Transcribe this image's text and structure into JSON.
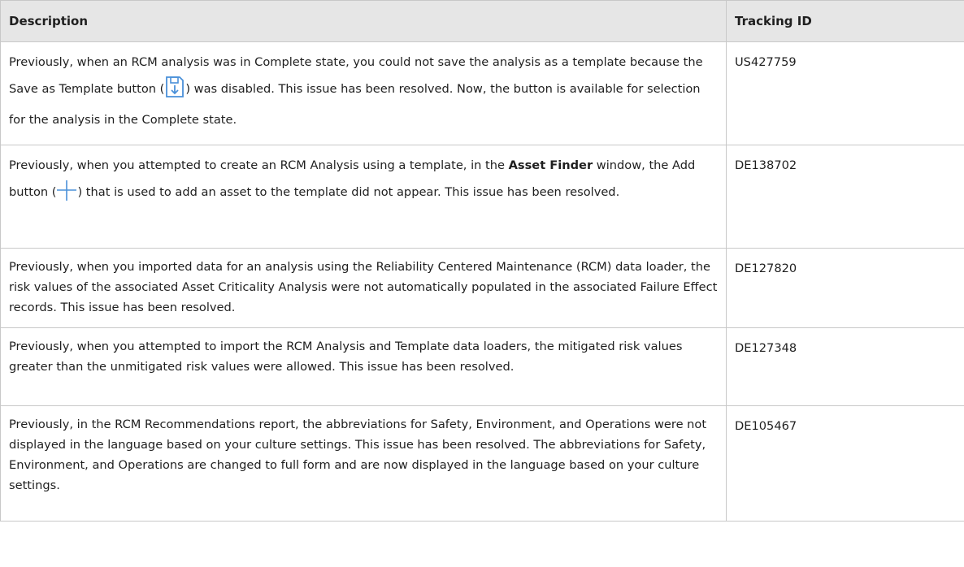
{
  "table": {
    "headers": {
      "description": "Description",
      "tracking_id": "Tracking ID"
    },
    "rows": [
      {
        "description_parts": [
          "Previously, when an RCM analysis was in Complete state, you could not save the analysis as a template because the Save as Template button (",
          ") was disabled. This issue has been resolved. Now, the button is available for selection for the analysis in the Complete state."
        ],
        "icon": "save-as-template-icon",
        "tracking_id": "US427759"
      },
      {
        "description_parts": [
          "Previously, when you attempted to create an RCM Analysis using a template, in the ",
          "Asset Finder",
          " window, the Add button (",
          ") that is used to add an asset to the template did not appear. This issue has been resolved."
        ],
        "icon": "add-icon",
        "tracking_id": "DE138702"
      },
      {
        "description": "Previously, when you imported data for an analysis using the Reliability Centered Maintenance (RCM) data loader, the risk values of the associated Asset Criticality Analysis were not automatically populated in the associated Failure Effect records. This issue has been resolved.",
        "tracking_id": "DE127820"
      },
      {
        "description": "Previously, when you attempted to import the RCM Analysis and Template data loaders, the mitigated risk values greater than the unmitigated risk values were allowed. This issue has been resolved.",
        "tracking_id": "DE127348"
      },
      {
        "description": "Previously, in the RCM Recommendations report, the abbreviations for Safety, Environment, and Operations were not displayed in the language based on your culture settings. This issue has been resolved. The abbreviations for Safety, Environment, and Operations are changed to full form and are now displayed in the language based on your culture settings.",
        "tracking_id": "DE105467"
      }
    ]
  },
  "colors": {
    "icon_blue": "#4a90d9",
    "header_bg": "#e6e6e6",
    "border": "#c8c8c8"
  }
}
